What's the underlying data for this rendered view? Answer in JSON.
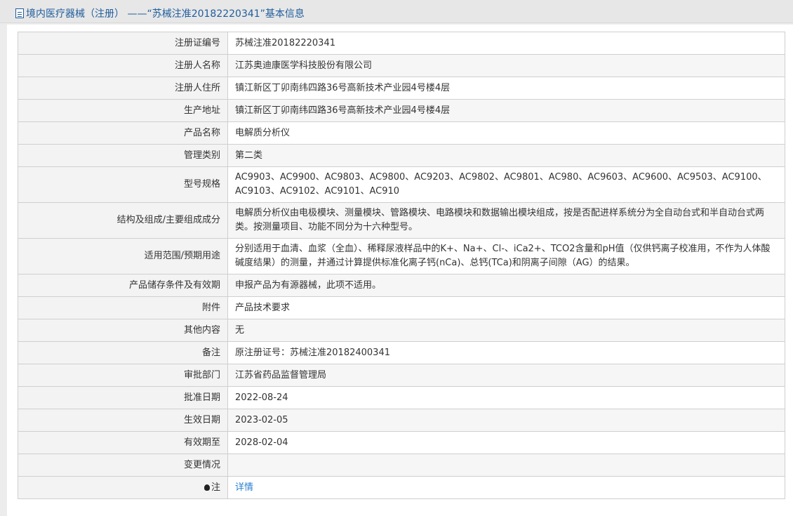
{
  "header": {
    "title": "境内医疗器械（注册） ——“苏械注准20182220341”基本信息"
  },
  "rows": [
    {
      "label": "注册证编号",
      "value": "苏械注准20182220341"
    },
    {
      "label": "注册人名称",
      "value": "江苏奥迪康医学科技股份有限公司"
    },
    {
      "label": "注册人住所",
      "value": "镇江新区丁卯南纬四路36号高新技术产业园4号楼4层"
    },
    {
      "label": "生产地址",
      "value": "镇江新区丁卯南纬四路36号高新技术产业园4号楼4层"
    },
    {
      "label": "产品名称",
      "value": "电解质分析仪"
    },
    {
      "label": "管理类别",
      "value": "第二类"
    },
    {
      "label": "型号规格",
      "value": "AC9903、AC9900、AC9803、AC9800、AC9203、AC9802、AC9801、AC980、AC9603、AC9600、AC9503、AC9100、AC9103、AC9102、AC9101、AC910"
    },
    {
      "label": "结构及组成/主要组成成分",
      "value": "电解质分析仪由电极模块、测量模块、管路模块、电路模块和数据输出模块组成，按是否配进样系统分为全自动台式和半自动台式两类。按测量项目、功能不同分为十六种型号。"
    },
    {
      "label": "适用范围/预期用途",
      "value": "分别适用于血清、血浆（全血）、稀释尿液样品中的K+、Na+、Cl-、iCa2+、TCO2含量和pH值（仅供钙离子校准用，不作为人体酸碱度结果）的测量，并通过计算提供标准化离子钙(nCa)、总钙(TCa)和阴离子间隙（AG）的结果。"
    },
    {
      "label": "产品储存条件及有效期",
      "value": "申报产品为有源器械，此项不适用。"
    },
    {
      "label": "附件",
      "value": "产品技术要求"
    },
    {
      "label": "其他内容",
      "value": "无"
    },
    {
      "label": "备注",
      "value": "原注册证号：苏械注准20182400341"
    },
    {
      "label": "审批部门",
      "value": "江苏省药品监督管理局"
    },
    {
      "label": "批准日期",
      "value": "2022-08-24"
    },
    {
      "label": "生效日期",
      "value": "2023-02-05"
    },
    {
      "label": "有效期至",
      "value": "2028-02-04"
    },
    {
      "label": "变更情况",
      "value": ""
    }
  ],
  "note_row": {
    "label": "注",
    "link_text": "详情",
    "icon": "lightbulb-icon"
  }
}
